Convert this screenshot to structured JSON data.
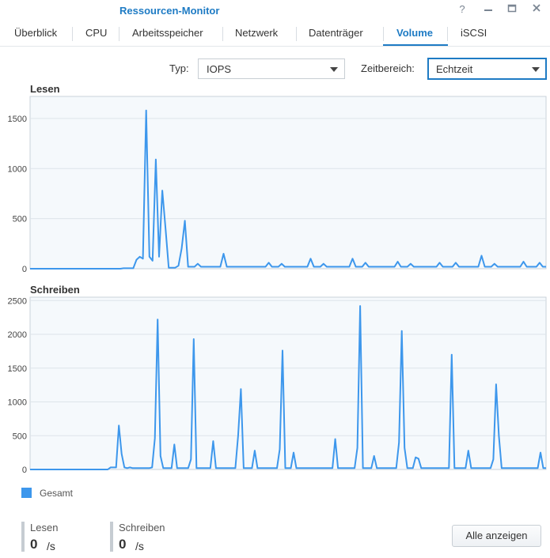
{
  "window": {
    "title": "Ressourcen-Monitor"
  },
  "tabs": [
    {
      "label": "Überblick"
    },
    {
      "label": "CPU"
    },
    {
      "label": "Arbeitsspeicher"
    },
    {
      "label": "Netzwerk"
    },
    {
      "label": "Datenträger"
    },
    {
      "label": "Volume",
      "active": true
    },
    {
      "label": "iSCSI"
    }
  ],
  "filters": {
    "type_label": "Typ:",
    "type_value": "IOPS",
    "range_label": "Zeitbereich:",
    "range_value": "Echtzeit"
  },
  "colors": {
    "series": "#3d97ec",
    "accent": "#1e7bc4",
    "plot_bg": "#f5f9fc"
  },
  "chart_data": [
    {
      "type": "line",
      "title": "Lesen",
      "ylim": [
        0,
        1720
      ],
      "yticks": [
        0,
        500,
        1000,
        1500
      ],
      "grid": true,
      "series": [
        {
          "name": "Gesamt",
          "values": [
            0,
            0,
            0,
            0,
            0,
            0,
            0,
            0,
            0,
            0,
            0,
            0,
            0,
            0,
            0,
            0,
            0,
            0,
            0,
            0,
            0,
            0,
            0,
            0,
            0,
            0,
            0,
            0,
            0,
            5,
            5,
            5,
            5,
            90,
            120,
            100,
            1580,
            120,
            80,
            1090,
            120,
            780,
            400,
            10,
            10,
            10,
            30,
            200,
            480,
            20,
            20,
            20,
            50,
            20,
            20,
            20,
            20,
            20,
            20,
            20,
            150,
            20,
            20,
            20,
            20,
            20,
            20,
            20,
            20,
            20,
            20,
            20,
            20,
            20,
            60,
            20,
            20,
            20,
            50,
            20,
            20,
            20,
            20,
            20,
            20,
            20,
            20,
            100,
            20,
            20,
            20,
            50,
            20,
            20,
            20,
            20,
            20,
            20,
            20,
            20,
            100,
            20,
            20,
            20,
            60,
            20,
            20,
            20,
            20,
            20,
            20,
            20,
            20,
            20,
            70,
            20,
            20,
            20,
            50,
            20,
            20,
            20,
            20,
            20,
            20,
            20,
            20,
            60,
            20,
            20,
            20,
            20,
            60,
            20,
            20,
            20,
            20,
            20,
            20,
            20,
            130,
            20,
            20,
            20,
            50,
            20,
            20,
            20,
            20,
            20,
            20,
            20,
            20,
            70,
            20,
            20,
            20,
            20,
            60,
            20,
            20
          ]
        }
      ]
    },
    {
      "type": "line",
      "title": "Schreiben",
      "ylim": [
        0,
        2550
      ],
      "yticks": [
        0,
        500,
        1000,
        1500,
        2000,
        2500
      ],
      "grid": true,
      "series": [
        {
          "name": "Gesamt",
          "values": [
            0,
            0,
            0,
            0,
            0,
            0,
            0,
            0,
            0,
            0,
            0,
            0,
            0,
            0,
            0,
            0,
            0,
            0,
            0,
            0,
            0,
            0,
            0,
            0,
            0,
            0,
            0,
            0,
            0,
            30,
            30,
            30,
            650,
            230,
            30,
            20,
            30,
            20,
            20,
            20,
            20,
            20,
            20,
            20,
            30,
            460,
            2220,
            200,
            20,
            20,
            20,
            20,
            370,
            20,
            20,
            20,
            20,
            20,
            150,
            1930,
            20,
            20,
            20,
            20,
            20,
            20,
            420,
            20,
            20,
            20,
            20,
            20,
            20,
            20,
            20,
            500,
            1190,
            20,
            20,
            20,
            20,
            280,
            20,
            20,
            20,
            20,
            20,
            20,
            20,
            20,
            300,
            1760,
            20,
            20,
            20,
            250,
            20,
            20,
            20,
            20,
            20,
            20,
            20,
            20,
            20,
            20,
            20,
            20,
            20,
            20,
            450,
            20,
            20,
            20,
            20,
            20,
            20,
            20,
            320,
            2420,
            20,
            20,
            20,
            20,
            200,
            20,
            20,
            20,
            20,
            20,
            20,
            20,
            20,
            400,
            2050,
            320,
            20,
            20,
            20,
            180,
            160,
            20,
            20,
            20,
            20,
            20,
            20,
            20,
            20,
            20,
            20,
            20,
            1700,
            20,
            20,
            20,
            20,
            20,
            280,
            20,
            20,
            20,
            20,
            20,
            20,
            20,
            20,
            150,
            1260,
            500,
            20,
            20,
            20,
            20,
            20,
            20,
            20,
            20,
            20,
            20,
            20,
            20,
            20,
            20,
            250,
            20,
            20
          ]
        }
      ]
    }
  ],
  "legend": {
    "label": "Gesamt"
  },
  "stats": {
    "read_label": "Lesen",
    "read_value": "0",
    "read_unit": "/s",
    "write_label": "Schreiben",
    "write_value": "0",
    "write_unit": "/s"
  },
  "actions": {
    "show_all": "Alle anzeigen"
  },
  "icons": [
    "help-icon",
    "pin-icon",
    "maximize-icon",
    "close-icon"
  ]
}
